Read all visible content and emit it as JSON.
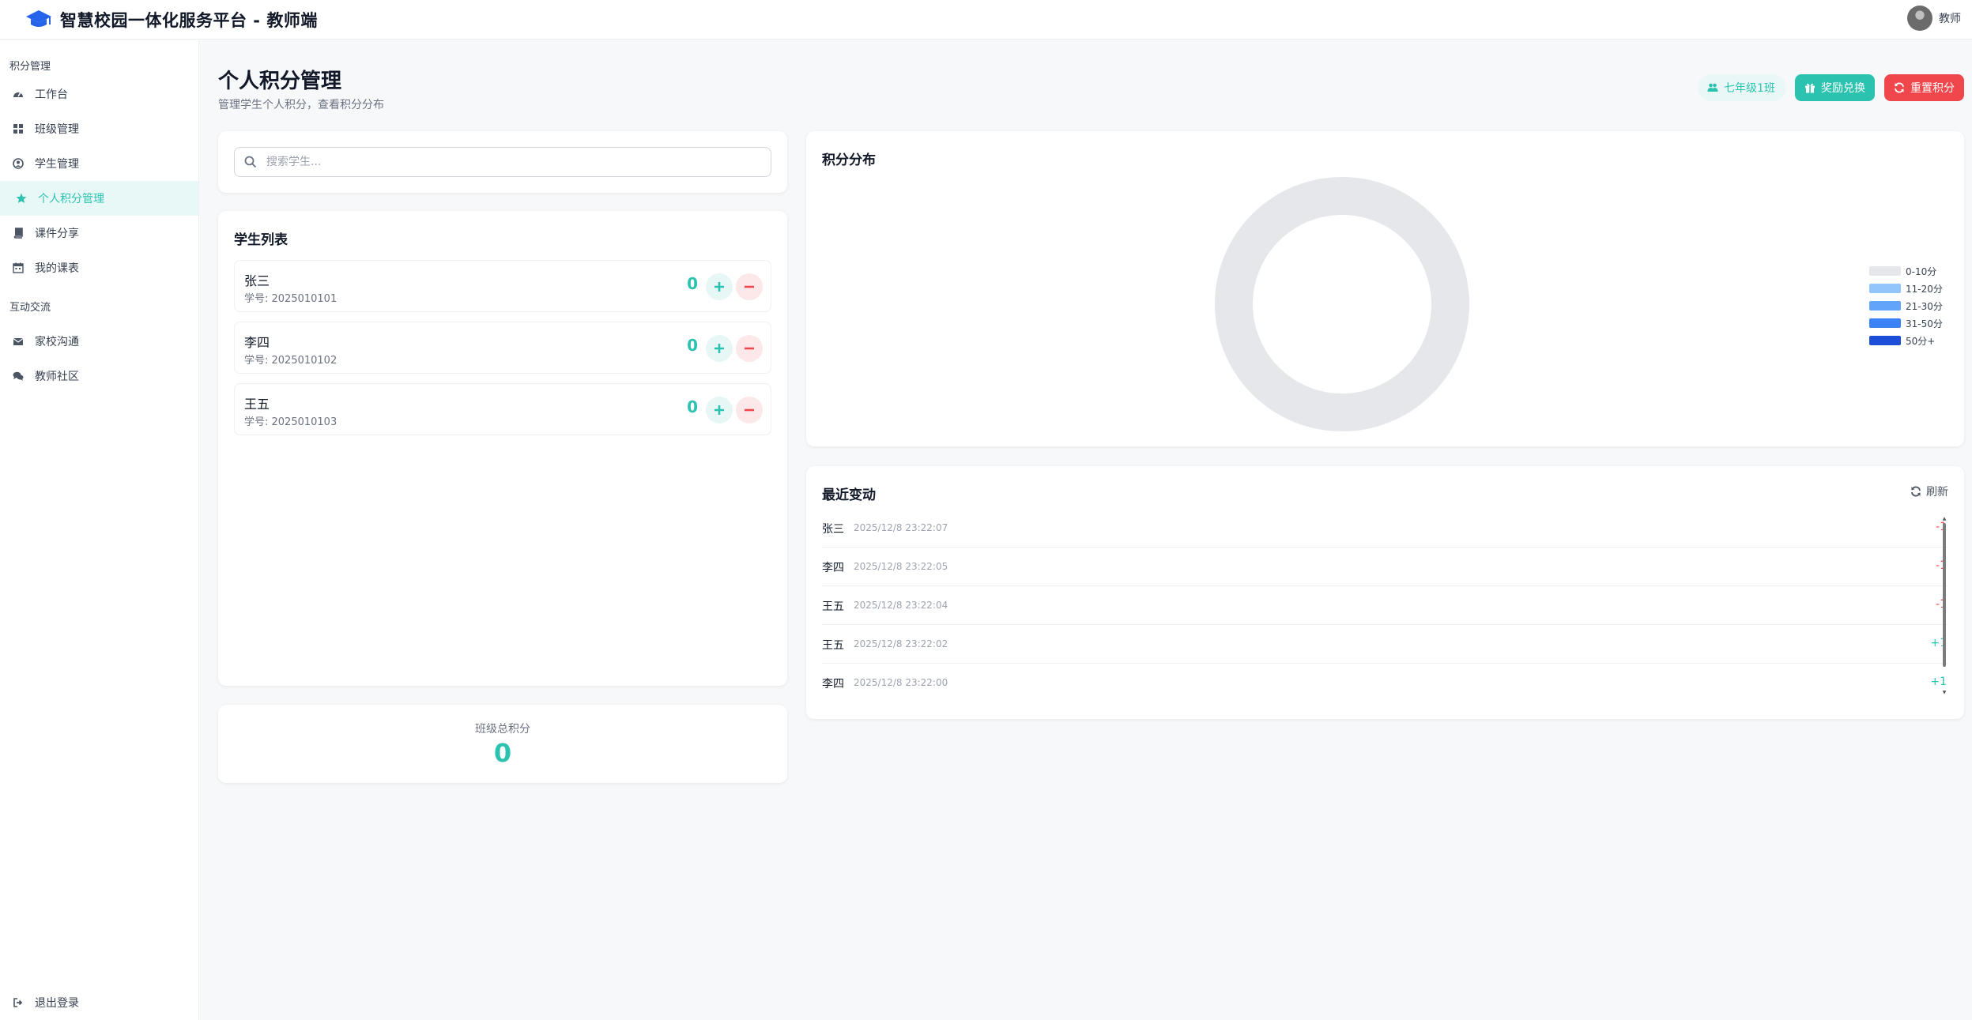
{
  "app": {
    "title": "智慧校园一体化服务平台 - 教师端",
    "user_name": "教师"
  },
  "sidebar": {
    "group1": "积分管理",
    "group2": "互动交流",
    "items": [
      {
        "label": "工作台",
        "icon": "dashboard-icon"
      },
      {
        "label": "班级管理",
        "icon": "grid-icon"
      },
      {
        "label": "学生管理",
        "icon": "user-circle-icon"
      },
      {
        "label": "个人积分管理",
        "icon": "star-icon",
        "active": true
      },
      {
        "label": "课件分享",
        "icon": "book-icon"
      },
      {
        "label": "我的课表",
        "icon": "calendar-icon"
      },
      {
        "label": "家校沟通",
        "icon": "envelope-icon"
      },
      {
        "label": "教师社区",
        "icon": "comments-icon"
      }
    ],
    "logout": "退出登录"
  },
  "header": {
    "title": "个人积分管理",
    "subtitle": "管理学生个人积分，查看积分分布",
    "class_button": "七年级1班",
    "reward_button": "奖励兑换",
    "reset_button": "重置积分"
  },
  "search": {
    "placeholder": "搜索学生..."
  },
  "student_list": {
    "title": "学生列表",
    "students": [
      {
        "name": "张三",
        "id": "学号: 2025010101",
        "score": "0"
      },
      {
        "name": "李四",
        "id": "学号: 2025010102",
        "score": "0"
      },
      {
        "name": "王五",
        "id": "学号: 2025010103",
        "score": "0"
      }
    ]
  },
  "total": {
    "label": "班级总积分",
    "value": "0"
  },
  "distribution": {
    "title": "积分分布",
    "legend": [
      {
        "label": "0-10分",
        "color": "#e5e7eb"
      },
      {
        "label": "11-20分",
        "color": "#93c5fd"
      },
      {
        "label": "21-30分",
        "color": "#60a5fa"
      },
      {
        "label": "31-50分",
        "color": "#3b82f6"
      },
      {
        "label": "50分+",
        "color": "#1d4ed8"
      }
    ]
  },
  "recent": {
    "title": "最近变动",
    "refresh": "刷新",
    "items": [
      {
        "name": "张三",
        "time": "2025/12/8 23:22:07",
        "delta": "-1",
        "type": "neg"
      },
      {
        "name": "李四",
        "time": "2025/12/8 23:22:05",
        "delta": "-1",
        "type": "neg"
      },
      {
        "name": "王五",
        "time": "2025/12/8 23:22:04",
        "delta": "-1",
        "type": "neg"
      },
      {
        "name": "王五",
        "time": "2025/12/8 23:22:02",
        "delta": "+1",
        "type": "pos"
      },
      {
        "name": "李四",
        "time": "2025/12/8 23:22:00",
        "delta": "+1",
        "type": "pos"
      }
    ]
  },
  "chart_data": {
    "type": "pie",
    "title": "积分分布",
    "categories": [
      "0-10分",
      "11-20分",
      "21-30分",
      "31-50分",
      "50分+"
    ],
    "values": [
      3,
      0,
      0,
      0,
      0
    ],
    "colors": [
      "#e5e7eb",
      "#93c5fd",
      "#60a5fa",
      "#3b82f6",
      "#1d4ed8"
    ],
    "legend_position": "right"
  }
}
